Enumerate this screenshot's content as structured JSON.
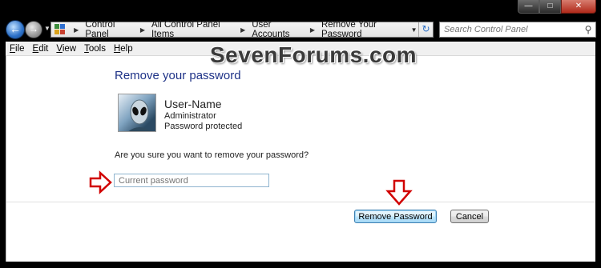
{
  "window": {
    "minimize_label": "—",
    "maximize_label": "□",
    "close_label": "✕"
  },
  "nav": {
    "back_icon": "back-arrow-icon",
    "forward_icon": "forward-arrow-icon",
    "breadcrumbs": [
      "Control Panel",
      "All Control Panel Items",
      "User Accounts",
      "Remove Your Password"
    ],
    "separator": "▶",
    "search_placeholder": "Search Control Panel"
  },
  "menu": {
    "items": [
      {
        "key": "F",
        "rest": "ile"
      },
      {
        "key": "E",
        "rest": "dit"
      },
      {
        "key": "V",
        "rest": "iew"
      },
      {
        "key": "T",
        "rest": "ools"
      },
      {
        "key": "H",
        "rest": "elp"
      }
    ]
  },
  "watermark": "SevenForums.com",
  "content": {
    "title": "Remove your password",
    "user": {
      "name": "User-Name",
      "role": "Administrator",
      "status": "Password protected"
    },
    "question": "Are you sure you want to remove your password?",
    "password_placeholder": "Current password",
    "remove_button": "Remove Password",
    "cancel_button": "Cancel"
  },
  "colors": {
    "title_blue": "#1e3287",
    "annotation_red": "#d10000"
  }
}
